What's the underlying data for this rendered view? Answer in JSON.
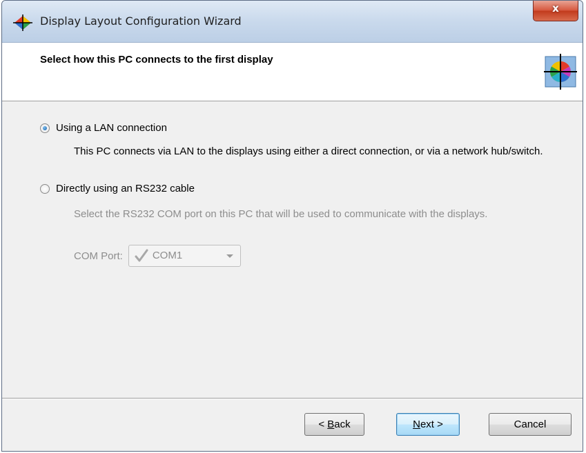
{
  "window": {
    "title": "Display Layout Configuration Wizard",
    "close_label": "x"
  },
  "header": {
    "title": "Select how this PC connects to the first display"
  },
  "options": [
    {
      "label": "Using a LAN connection",
      "checked": true,
      "description": "This PC connects via LAN to the displays using either a direct connection, or via a network hub/switch."
    },
    {
      "label": "Directly using an RS232 cable",
      "checked": false,
      "description": "Select the RS232 COM port on this PC that will be used to communicate with the displays."
    }
  ],
  "com_port": {
    "label": "COM Port:",
    "value": "COM1",
    "enabled": false
  },
  "buttons": {
    "back": {
      "label": "Back",
      "accel": "B",
      "rest": "ack",
      "prefix": "< "
    },
    "next": {
      "label": "Next >",
      "accel": "N",
      "rest": "ext >"
    },
    "cancel": {
      "label": "Cancel"
    }
  }
}
